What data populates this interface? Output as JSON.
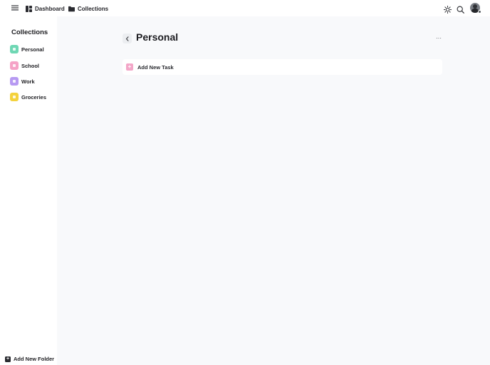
{
  "topbar": {
    "nav": [
      {
        "label": "Dashboard",
        "icon": "dashboard-icon"
      },
      {
        "label": "Collections",
        "icon": "folder-icon"
      }
    ],
    "icons": [
      "menu-icon",
      "sun-icon",
      "search-icon"
    ],
    "avatar": {
      "status_color": "#555a60"
    }
  },
  "sidebar": {
    "title": "Collections",
    "items": [
      {
        "label": "Personal",
        "color": "#6fd7b4"
      },
      {
        "label": "School",
        "color": "#f5a3c7"
      },
      {
        "label": "Work",
        "color": "#b79af2"
      },
      {
        "label": "Groceries",
        "color": "#f4d23d"
      }
    ],
    "add_folder_label": "Add New Folder"
  },
  "main": {
    "title": "Personal",
    "more_label": "···",
    "add_task_label": "Add New Task",
    "add_task_color": "#f3a6c8"
  }
}
